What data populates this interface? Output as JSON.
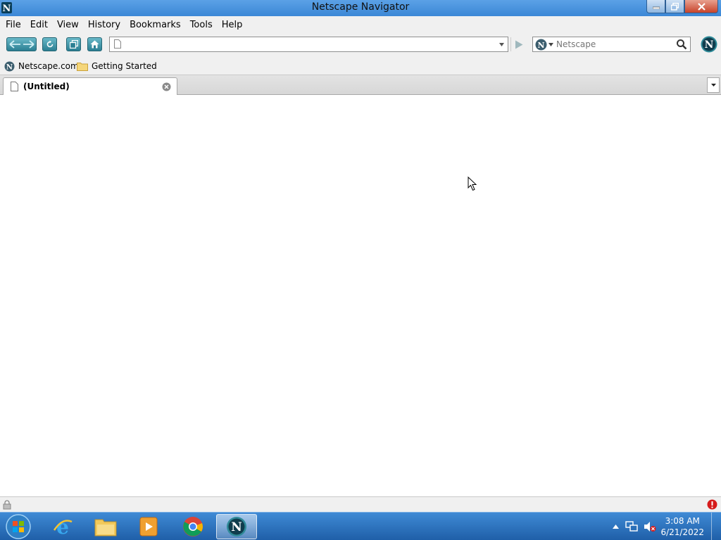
{
  "window": {
    "title": "Netscape Navigator"
  },
  "menu": {
    "items": [
      "File",
      "Edit",
      "View",
      "History",
      "Bookmarks",
      "Tools",
      "Help"
    ]
  },
  "navbar": {
    "url_value": "",
    "search_placeholder": "Netscape"
  },
  "bookmarks": {
    "items": [
      "Netscape.com",
      "Getting Started"
    ]
  },
  "tabs": [
    {
      "label": "(Untitled)",
      "active": true
    }
  ],
  "taskbar": {
    "apps": [
      "start-orb-icon",
      "internet-explorer-icon",
      "file-explorer-icon",
      "media-player-icon",
      "chrome-icon",
      "netscape-icon"
    ],
    "time": "3:08 AM",
    "date": "6/21/2022"
  },
  "colors": {
    "titlebar": "#3b87d6",
    "taskbar": "#1f5fa8",
    "toolbar_button": "#2b7f93"
  }
}
